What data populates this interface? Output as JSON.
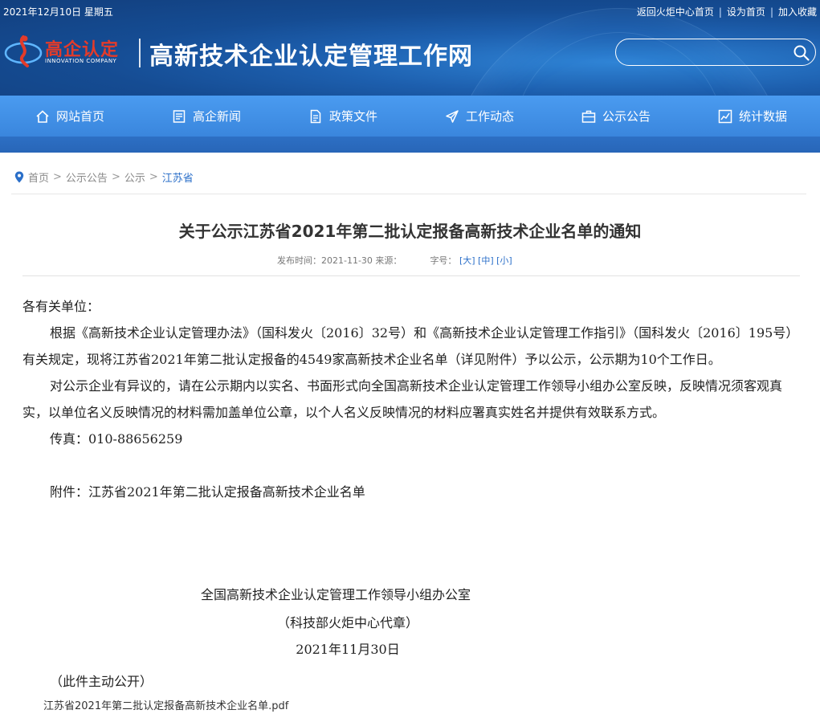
{
  "top": {
    "date": "2021年12月10日 星期五",
    "links": [
      "返回火炬中心首页",
      "设为首页",
      "加入收藏"
    ]
  },
  "logo": {
    "cn": "高企认定",
    "en": "INNOVATION COMPANY"
  },
  "site_title": "高新技术企业认定管理工作网",
  "search": {
    "placeholder": ""
  },
  "nav": [
    {
      "label": "网站首页",
      "icon": "home-icon"
    },
    {
      "label": "高企新闻",
      "icon": "news-icon"
    },
    {
      "label": "政策文件",
      "icon": "document-icon"
    },
    {
      "label": "工作动态",
      "icon": "paper-plane-icon"
    },
    {
      "label": "公示公告",
      "icon": "briefcase-icon"
    },
    {
      "label": "统计数据",
      "icon": "chart-icon"
    }
  ],
  "breadcrumb": {
    "items": [
      "首页",
      "公示公告",
      "公示"
    ],
    "current": "江苏省"
  },
  "article": {
    "title": "关于公示江苏省2021年第二批认定报备高新技术企业名单的通知",
    "meta_publish": "发布时间：2021-11-30 来源：",
    "meta_size_label": "字号：",
    "size_options": [
      "[大]",
      "[中]",
      "[小]"
    ],
    "salutation": "各有关单位：",
    "para1": "根据《高新技术企业认定管理办法》（国科发火〔2016〕32号）和《高新技术企业认定管理工作指引》（国科发火〔2016〕195号）有关规定，现将江苏省2021年第二批认定报备的4549家高新技术企业名单（详见附件）予以公示，公示期为10个工作日。",
    "para2": "对公示企业有异议的，请在公示期内以实名、书面形式向全国高新技术企业认定管理工作领导小组办公室反映，反映情况须客观真实，以单位名义反映情况的材料需加盖单位公章，以个人名义反映情况的材料应署真实姓名并提供有效联系方式。",
    "fax": "传真：010-88656259",
    "attachment_note": "附件：江苏省2021年第二批认定报备高新技术企业名单",
    "sign_org": "全国高新技术企业认定管理工作领导小组办公室",
    "sign_seal": "（科技部火炬中心代章）",
    "sign_date": "2021年11月30日",
    "public_note": "（此件主动公开）",
    "attachment_link": "江苏省2021年第二批认定报备高新技术企业名单.pdf"
  }
}
